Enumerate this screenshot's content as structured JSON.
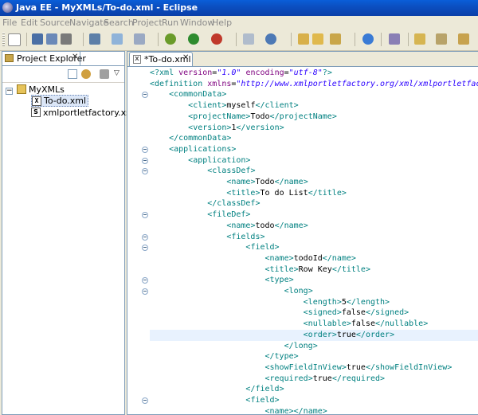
{
  "window": {
    "title": "Java EE - MyXMLs/To-do.xml - Eclipse"
  },
  "menu": [
    "File",
    "Edit",
    "Source",
    "Navigate",
    "Search",
    "Project",
    "Run",
    "Window",
    "Help"
  ],
  "toolbar": {
    "icons": [
      "new-wizard-icon",
      "save-icon",
      "save-all-icon",
      "print-icon",
      "debug-icon",
      "run-icon",
      "external-tools-icon",
      "new-java-project-icon",
      "new-class-icon",
      "open-type-icon",
      "search-icon",
      "globe-icon",
      "annotation-icon",
      "next-annotation-icon"
    ],
    "colors": {
      "run": "#2e8b2e",
      "debug": "#6a9b2a",
      "tools": "#c0392b"
    }
  },
  "explorer": {
    "tab_label": "Project Explorer",
    "tree": [
      {
        "label": "MyXMLs",
        "icon": "project-folder-icon",
        "level": 0,
        "expanded": true
      },
      {
        "label": "To-do.xml",
        "icon": "xml-file-icon",
        "level": 1,
        "selected": true
      },
      {
        "label": "xmlportletfactory.xsd",
        "icon": "xsd-file-icon",
        "level": 1
      }
    ]
  },
  "editor": {
    "tab_label": "*To-do.xml",
    "current_line": 24,
    "lines": [
      {
        "text": "<?xml version=\"1.0\" encoding=\"utf-8\"?>",
        "fold": false
      },
      {
        "text": "<definition xmlns=\"http://www.xmlportletfactory.org/xml/xmlportletfactory\"",
        "fold": false
      },
      {
        "text": "    <commonData>",
        "fold": true
      },
      {
        "text": "        <client>myself</client>",
        "fold": false
      },
      {
        "text": "        <projectName>Todo</projectName>",
        "fold": false
      },
      {
        "text": "        <version>1</version>",
        "fold": false
      },
      {
        "text": "    </commonData>",
        "fold": false
      },
      {
        "text": "    <applications>",
        "fold": true
      },
      {
        "text": "        <application>",
        "fold": true
      },
      {
        "text": "            <classDef>",
        "fold": true
      },
      {
        "text": "                <name>Todo</name>",
        "fold": false
      },
      {
        "text": "                <title>To do List</title>",
        "fold": false
      },
      {
        "text": "            </classDef>",
        "fold": false
      },
      {
        "text": "            <fileDef>",
        "fold": true
      },
      {
        "text": "                <name>todo</name>",
        "fold": false
      },
      {
        "text": "                <fields>",
        "fold": true
      },
      {
        "text": "                    <field>",
        "fold": true
      },
      {
        "text": "                        <name>todoId</name>",
        "fold": false
      },
      {
        "text": "                        <title>Row Key</title>",
        "fold": false
      },
      {
        "text": "                        <type>",
        "fold": true
      },
      {
        "text": "                            <long>",
        "fold": true
      },
      {
        "text": "                                <length>5</length>",
        "fold": false
      },
      {
        "text": "                                <signed>false</signed>",
        "fold": false
      },
      {
        "text": "                                <nullable>false</nullable>",
        "fold": false
      },
      {
        "text": "                                <order>true</order>",
        "fold": false
      },
      {
        "text": "                            </long>",
        "fold": false
      },
      {
        "text": "                        </type>",
        "fold": false
      },
      {
        "text": "                        <showFieldInView>true</showFieldInView>",
        "fold": false
      },
      {
        "text": "                        <required>true</required>",
        "fold": false
      },
      {
        "text": "                    </field>",
        "fold": false
      },
      {
        "text": "                    <field>",
        "fold": true
      },
      {
        "text": "                        <name></name>",
        "fold": false
      }
    ],
    "colors": {
      "tag": "#008080",
      "attr": "#7f007f",
      "value": "#2a00ff",
      "text": "#000000",
      "current_line_bg": "#e8f2fe"
    }
  }
}
